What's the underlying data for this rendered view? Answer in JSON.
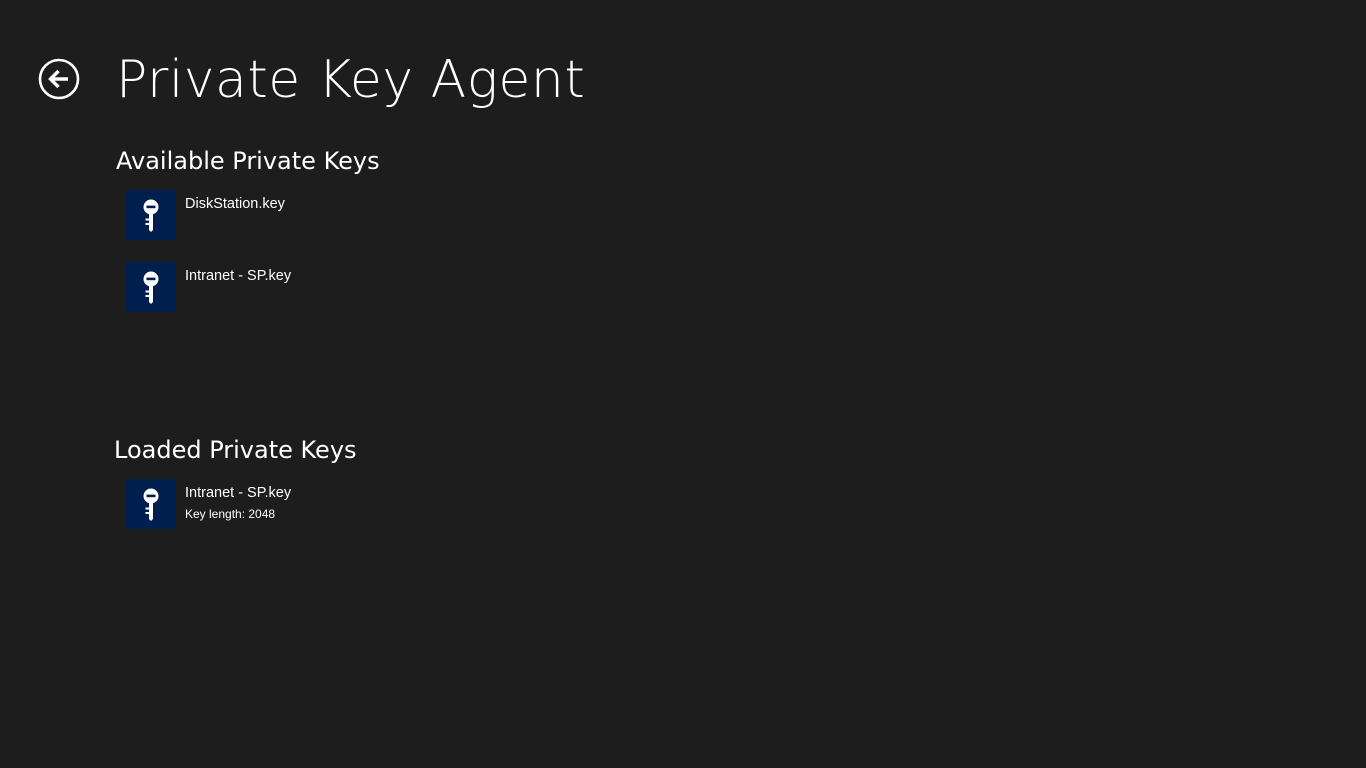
{
  "header": {
    "title": "Private Key Agent",
    "back_icon": "back-arrow-icon"
  },
  "available": {
    "heading": "Available Private Keys",
    "items": [
      {
        "name": "DiskStation.key",
        "icon": "key-icon"
      },
      {
        "name": "Intranet - SP.key",
        "icon": "key-icon"
      }
    ]
  },
  "loaded": {
    "heading": "Loaded Private Keys",
    "items": [
      {
        "name": "Intranet - SP.key",
        "detail": "Key length: 2048",
        "icon": "key-icon"
      }
    ]
  },
  "colors": {
    "background": "#1d1d1d",
    "tile": "#001e4e",
    "text": "#ffffff"
  }
}
